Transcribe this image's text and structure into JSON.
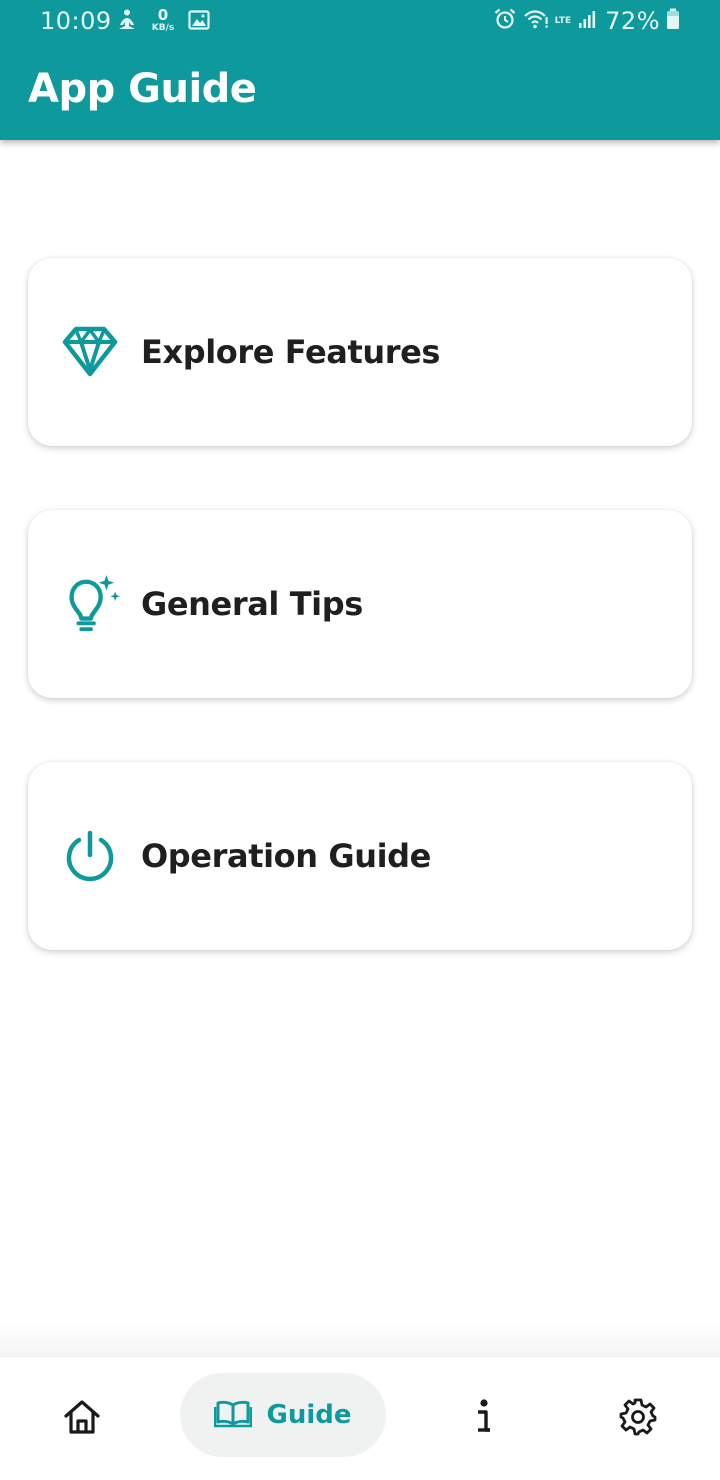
{
  "status_bar": {
    "time": "10:09",
    "data_speed_value": "0",
    "data_speed_unit": "KB/s",
    "lte_label": "LTE",
    "battery_percent": "72%"
  },
  "header": {
    "title": "App Guide"
  },
  "cards": [
    {
      "label": "Explore Features",
      "icon": "diamond-icon"
    },
    {
      "label": "General Tips",
      "icon": "lightbulb-sparkle-icon"
    },
    {
      "label": "Operation Guide",
      "icon": "power-icon"
    }
  ],
  "bottom_nav": {
    "items": [
      {
        "icon": "home-icon",
        "label": ""
      },
      {
        "icon": "open-book-icon",
        "label": "Guide",
        "selected": true
      },
      {
        "icon": "info-icon",
        "label": ""
      },
      {
        "icon": "gear-icon",
        "label": ""
      }
    ]
  },
  "colors": {
    "accent": "#0e9a9c",
    "text_primary": "#1f1f1f",
    "nav_selected_bg": "#f0f2f2"
  }
}
